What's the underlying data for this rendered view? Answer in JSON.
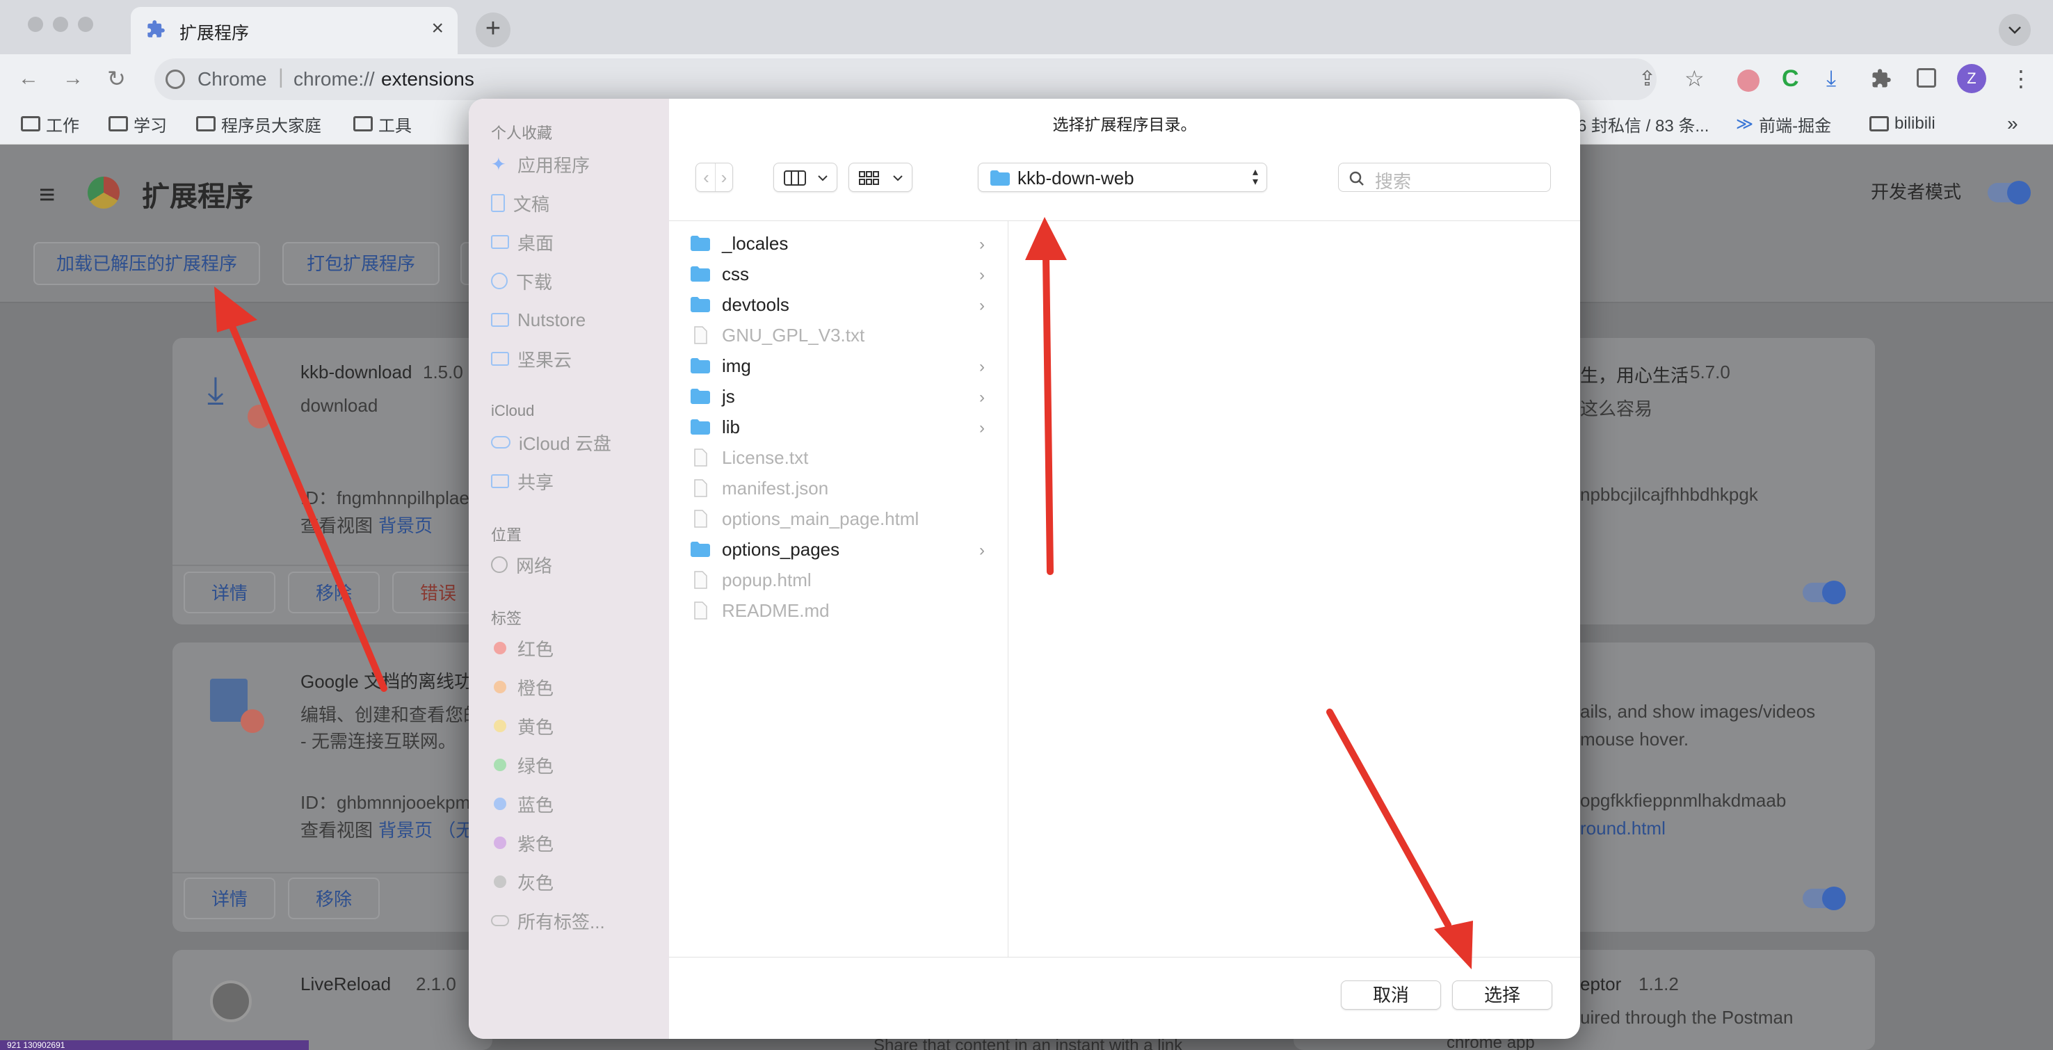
{
  "browser": {
    "tab_title": "扩展程序",
    "new_tab_glyph": "+",
    "url_host": "Chrome",
    "url_scheme": "chrome://",
    "url_path": "extensions",
    "profile_initial": "Z",
    "bookmarks": [
      {
        "label": "工作",
        "icon": "folder-icon"
      },
      {
        "label": "学习",
        "icon": "folder-icon"
      },
      {
        "label": "程序员大家庭",
        "icon": "folder-icon"
      },
      {
        "label": "工具",
        "icon": "folder-icon"
      }
    ],
    "bookmarks_right": [
      {
        "label": "6 封私信 / 83 条..."
      },
      {
        "label": "前端-掘金"
      },
      {
        "label": "bilibili"
      }
    ],
    "bookmarks_more": "»"
  },
  "extensions_page": {
    "title": "扩展程序",
    "dev_mode_label": "开发者模式",
    "buttons": {
      "load_unpacked": "加载已解压的扩展程序",
      "pack": "打包扩展程序"
    },
    "cards": [
      {
        "name": "kkb-download",
        "version": "1.5.0",
        "desc": "download",
        "id_line": "ID：fngmhnnpilhplae",
        "views_prefix": "查看视图",
        "views_link": "背景页",
        "buttons": [
          "详情",
          "移除",
          "错误"
        ]
      },
      {
        "name": "Google 文档的离线功",
        "desc_line1": "编辑、创建和查看您的",
        "desc_line2": "- 无需连接互联网。",
        "id_line": "ID：ghbmnnjooekpm",
        "views_prefix": "查看视图",
        "views_link": "背景页 （无",
        "buttons": [
          "详情",
          "移除"
        ]
      },
      {
        "name": "LiveReload",
        "version": "2.1.0",
        "desc": "Share that content in an instant with a link"
      }
    ],
    "right_cards": [
      {
        "name_tail": "生，用心生活",
        "version": "5.7.0",
        "desc_tail": "这么容易",
        "id_tail": "npbbcjilcajfhhbdhkpgk"
      },
      {
        "desc_line1": "ails, and show images/videos",
        "desc_line2": "mouse hover.",
        "id_tail": "opgfkkfieppnmlhakdmaab",
        "link_tail": "round.html"
      },
      {
        "name_tail": "eptor",
        "version": "1.1.2",
        "desc_tail": "uired through the Postman",
        "extra": "chrome app"
      }
    ],
    "status_bar_text": "921 130902691"
  },
  "dialog": {
    "title": "选择扩展程序目录。",
    "sidebar": {
      "favorites_header": "个人收藏",
      "favorites": [
        {
          "label": "应用程序",
          "icon": "applications-icon"
        },
        {
          "label": "文稿",
          "icon": "document-icon"
        },
        {
          "label": "桌面",
          "icon": "desktop-icon"
        },
        {
          "label": "下载",
          "icon": "download-icon"
        },
        {
          "label": "Nutstore",
          "icon": "folder-icon"
        },
        {
          "label": "坚果云",
          "icon": "folder-icon"
        }
      ],
      "icloud_header": "iCloud",
      "icloud": [
        {
          "label": "iCloud 云盘",
          "icon": "cloud-icon"
        },
        {
          "label": "共享",
          "icon": "shared-folder-icon"
        }
      ],
      "locations_header": "位置",
      "locations": [
        {
          "label": "网络",
          "icon": "network-icon"
        }
      ],
      "tags_header": "标签",
      "tags": [
        {
          "label": "红色",
          "color": "#f3a4a1"
        },
        {
          "label": "橙色",
          "color": "#f6c8a0"
        },
        {
          "label": "黄色",
          "color": "#f5e1a0"
        },
        {
          "label": "绿色",
          "color": "#a9dfb2"
        },
        {
          "label": "蓝色",
          "color": "#a9c6f5"
        },
        {
          "label": "紫色",
          "color": "#d6b2e6"
        },
        {
          "label": "灰色",
          "color": "#c8c8c8"
        }
      ],
      "all_tags": "所有标签..."
    },
    "location": "kkb-down-web",
    "search_placeholder": "搜索",
    "files": [
      {
        "name": "_locales",
        "type": "folder",
        "enabled": true
      },
      {
        "name": "css",
        "type": "folder",
        "enabled": true
      },
      {
        "name": "devtools",
        "type": "folder",
        "enabled": true
      },
      {
        "name": "GNU_GPL_V3.txt",
        "type": "txt",
        "enabled": false
      },
      {
        "name": "img",
        "type": "folder",
        "enabled": true
      },
      {
        "name": "js",
        "type": "folder",
        "enabled": true
      },
      {
        "name": "lib",
        "type": "folder",
        "enabled": true
      },
      {
        "name": "License.txt",
        "type": "txt",
        "enabled": false
      },
      {
        "name": "manifest.json",
        "type": "json",
        "enabled": false
      },
      {
        "name": "options_main_page.html",
        "type": "html",
        "enabled": false
      },
      {
        "name": "options_pages",
        "type": "folder",
        "enabled": true
      },
      {
        "name": "popup.html",
        "type": "html",
        "enabled": false
      },
      {
        "name": "README.md",
        "type": "md",
        "enabled": false
      }
    ],
    "cancel_label": "取消",
    "choose_label": "选择"
  },
  "colors": {
    "folder": "#59b3f0",
    "arrow": "#e5352a",
    "accent": "#1a73e8"
  }
}
